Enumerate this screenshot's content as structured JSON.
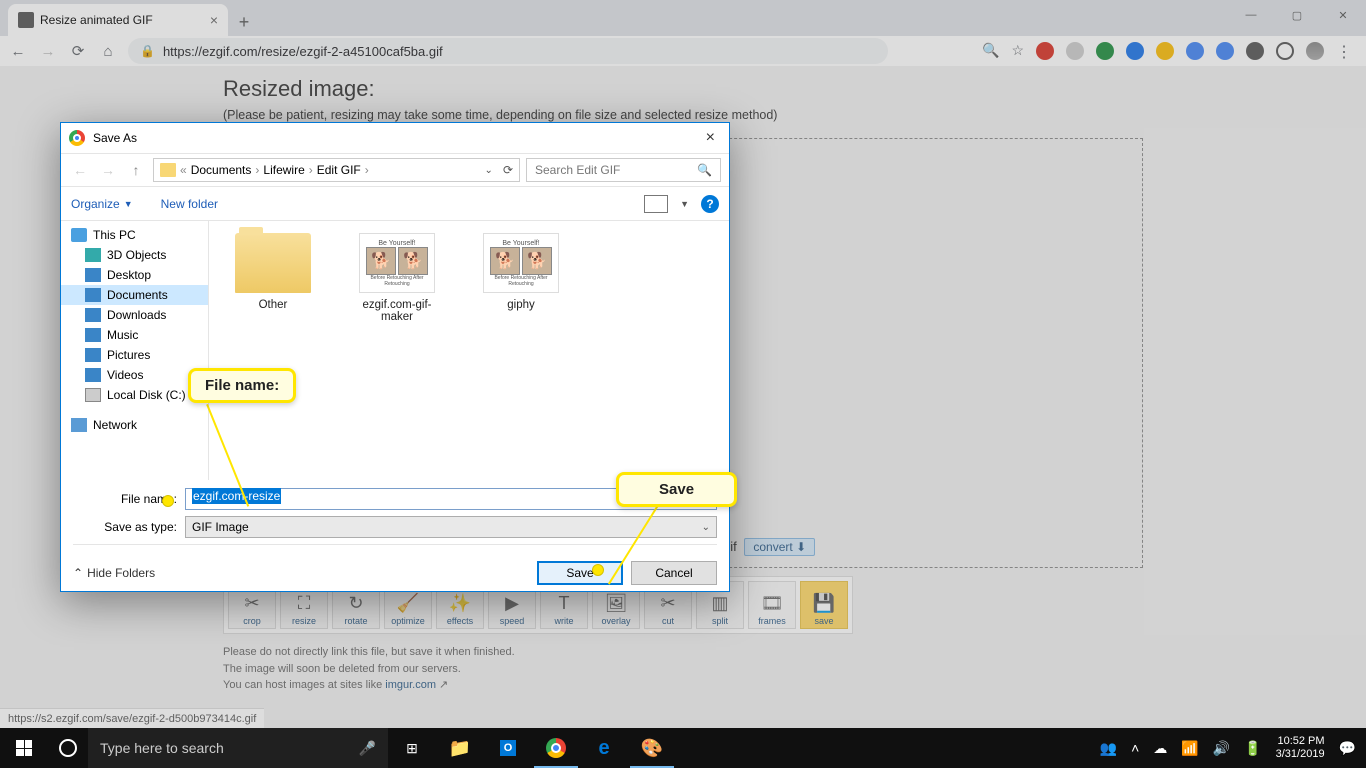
{
  "browser": {
    "tabTitle": "Resize animated GIF",
    "url": "https://ezgif.com/resize/ezgif-2-a45100caf5ba.gif",
    "winControls": {
      "min": "—",
      "max": "▢",
      "close": "✕"
    }
  },
  "page": {
    "heading": "Resized image:",
    "sub": "(Please be patient, resizing may take some time, depending on file size and selected resize method)",
    "infoLabel": ", type: gif",
    "convert": "convert",
    "tools": [
      "crop",
      "resize",
      "rotate",
      "optimize",
      "effects",
      "speed",
      "write",
      "overlay",
      "cut",
      "split",
      "frames",
      "save"
    ],
    "footer1": "Please do not directly link this file, but save it when finished.",
    "footer2": "The image will soon be deleted from our servers.",
    "footer3": "You can host images at sites like ",
    "footerLink": "imgur.com",
    "statusUrl": "https://s2.ezgif.com/save/ezgif-2-d500b973414c.gif"
  },
  "dialog": {
    "title": "Save As",
    "breadcrumb": {
      "p1": "Documents",
      "p2": "Lifewire",
      "p3": "Edit GIF"
    },
    "searchPlaceholder": "Search Edit GIF",
    "organize": "Organize",
    "newFolder": "New folder",
    "nav": {
      "thispc": "This PC",
      "obj3d": "3D Objects",
      "desktop": "Desktop",
      "documents": "Documents",
      "downloads": "Downloads",
      "music": "Music",
      "pictures": "Pictures",
      "videos": "Videos",
      "localdisk": "Local Disk (C:)",
      "network": "Network"
    },
    "items": {
      "folder": "Other",
      "gif1": "ezgif.com-gif-maker",
      "gif2": "giphy",
      "gifTop": "Be Yourself!"
    },
    "fileNameLabel": "File name:",
    "fileNameValue": "ezgif.com-resize",
    "saveTypeLabel": "Save as type:",
    "saveTypeValue": "GIF Image",
    "hideFolders": "Hide Folders",
    "saveBtn": "Save",
    "cancelBtn": "Cancel"
  },
  "callouts": {
    "fileName": "File name:",
    "save": "Save"
  },
  "taskbar": {
    "searchPlaceholder": "Type here to search",
    "time": "10:52 PM",
    "date": "3/31/2019"
  }
}
